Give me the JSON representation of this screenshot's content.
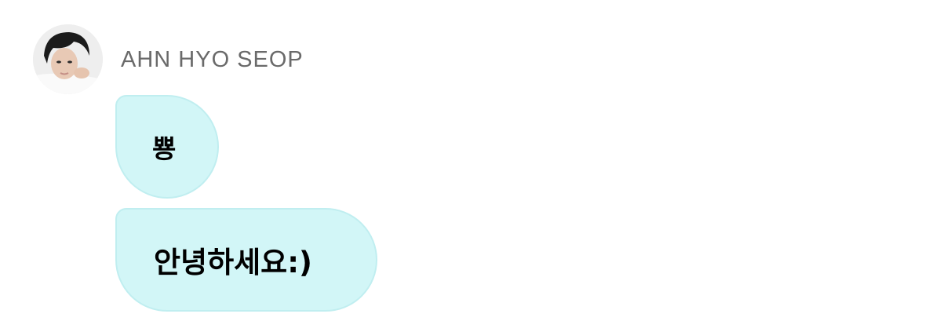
{
  "sender": {
    "name": "AHN HYO SEOP",
    "avatar_icon": "profile-photo"
  },
  "messages": [
    {
      "text": "뿅"
    },
    {
      "text": "안녕하세요:)"
    }
  ],
  "colors": {
    "bubble_fill": "#d2f6f7",
    "bubble_border": "#c0eef0",
    "name_text": "#6a6a6a",
    "message_text": "#000000",
    "background": "#ffffff"
  }
}
